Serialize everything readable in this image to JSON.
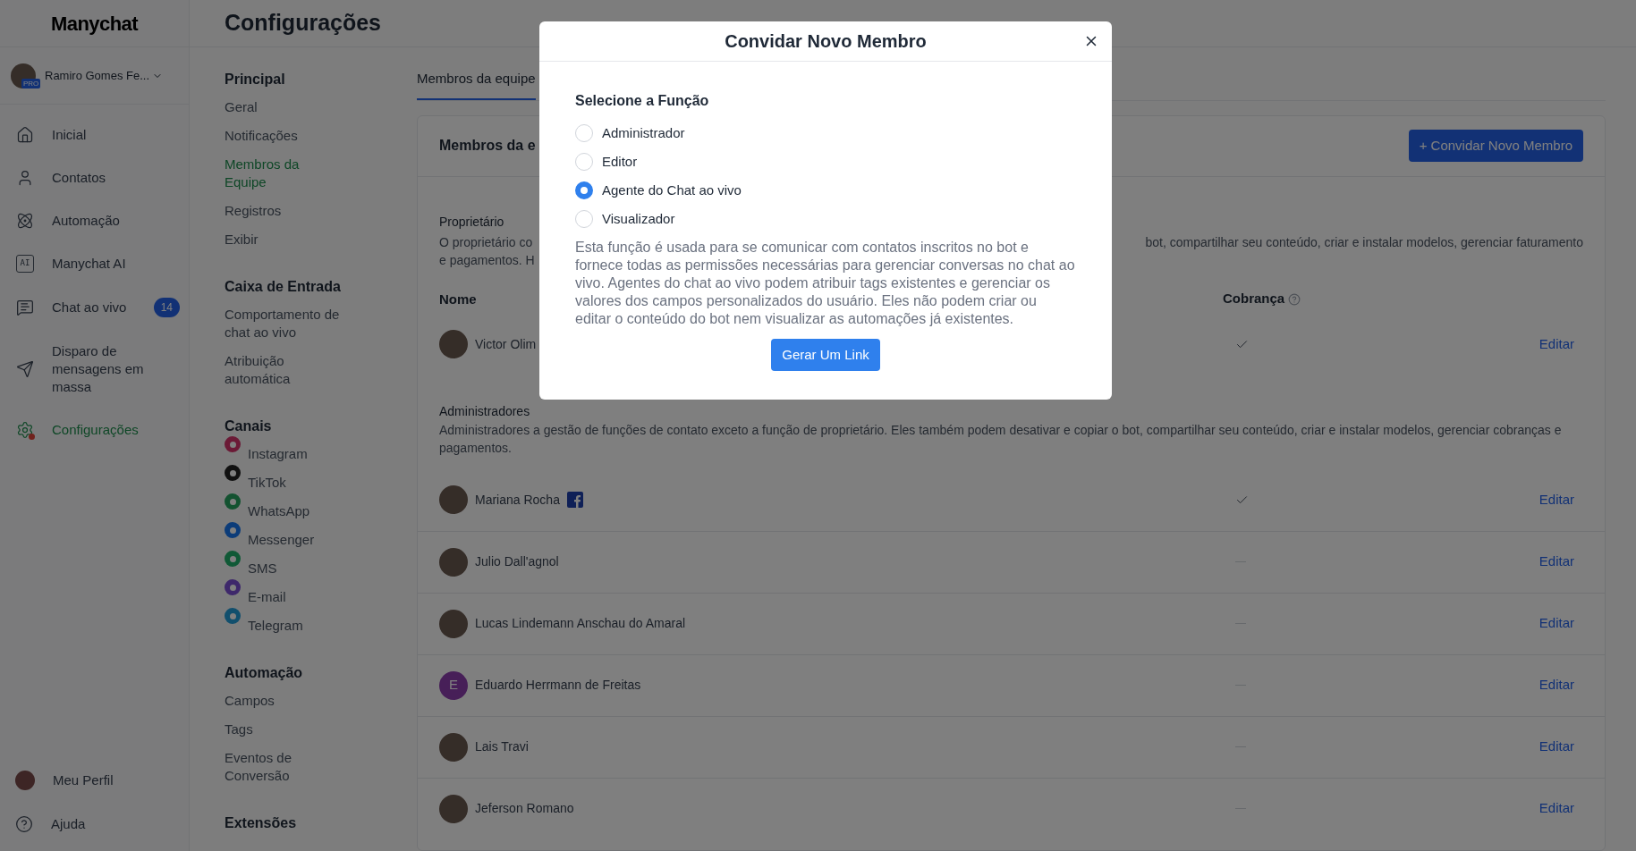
{
  "app": {
    "logo": "Manychat",
    "user": {
      "name": "Ramiro Gomes Fe...",
      "badge": "PRO"
    }
  },
  "sidebar": {
    "items": [
      {
        "kind": "home",
        "label": "Inicial",
        "selected": false
      },
      {
        "kind": "user",
        "label": "Contatos",
        "selected": false
      },
      {
        "kind": "atom",
        "label": "Automação",
        "selected": false
      },
      {
        "kind": "ai",
        "label": "Manychat AI",
        "selected": false,
        "icon_text": "AI"
      },
      {
        "kind": "chat",
        "label": "Chat ao vivo",
        "selected": false,
        "count": "14"
      },
      {
        "kind": "send",
        "label": "Disparo de mensagens em massa",
        "selected": false
      },
      {
        "kind": "settings",
        "label": "Configurações",
        "selected": true
      }
    ],
    "bottom": [
      {
        "kind": "avatar",
        "label": "Meu Perfil"
      },
      {
        "kind": "help",
        "label": "Ajuda"
      }
    ]
  },
  "page": {
    "title": "Configurações"
  },
  "settings_nav": [
    {
      "heading": "Principal",
      "items": [
        {
          "label": "Geral",
          "selected": false
        },
        {
          "label": "Notificações",
          "selected": false
        },
        {
          "label": "Membros da Equipe",
          "selected": true
        },
        {
          "label": "Registros",
          "selected": false
        },
        {
          "label": "Exibir",
          "selected": false
        }
      ]
    },
    {
      "heading": "Caixa de Entrada",
      "items": [
        {
          "label": "Comportamento de chat ao vivo",
          "selected": false
        },
        {
          "label": "Atribuição automática",
          "selected": false
        }
      ]
    },
    {
      "heading": "Canais",
      "items": [
        {
          "label": "Instagram",
          "selected": false,
          "color": "#6b1a36"
        },
        {
          "label": "TikTok",
          "selected": false,
          "color": "#111111"
        },
        {
          "label": "WhatsApp",
          "selected": false,
          "color": "#135230"
        },
        {
          "label": "Messenger",
          "selected": false,
          "color": "#0c3c79"
        },
        {
          "label": "SMS",
          "selected": false,
          "color": "#105936"
        },
        {
          "label": "E-mail",
          "selected": false,
          "color": "#3e286b"
        },
        {
          "label": "Telegram",
          "selected": false,
          "color": "#114f6d"
        }
      ]
    },
    {
      "heading": "Automação",
      "items": [
        {
          "label": "Campos",
          "selected": false
        },
        {
          "label": "Tags",
          "selected": false
        },
        {
          "label": "Eventos de Conversão",
          "selected": false
        }
      ]
    },
    {
      "heading": "Extensões"
    }
  ],
  "tabs": [
    {
      "label": "Membros da equipe",
      "selected": true
    }
  ],
  "card": {
    "title": "Membros da e",
    "invite_button": "+ Convidar Novo Membro",
    "owner": {
      "heading": "Proprietário",
      "description_left": [
        "O proprietário co",
        "e pagamentos. H"
      ],
      "description_right": "bot, compartilhar seu conteúdo, criar e instalar modelos, gerenciar faturamento"
    },
    "columns": [
      "Nome",
      "Cobrança"
    ],
    "owner_rows": [
      {
        "name": "Victor Olim",
        "billing": true,
        "action": "Editar"
      }
    ],
    "admins": {
      "heading": "Administradores",
      "description": "Administradores a gestão de funções de contato exceto a função de proprietário. Eles também podem desativar e copiar o bot, compartilhar seu conteúdo, criar e instalar modelos, gerenciar cobranças e pagamentos."
    },
    "admin_rows": [
      {
        "name": "Mariana Rocha",
        "facebook_badge": true,
        "billing": true,
        "action": "Editar"
      },
      {
        "name": "Julio Dall'agnol",
        "billing": false,
        "action": "Editar"
      },
      {
        "name": "Lucas Lindemann Anschau do Amaral",
        "billing": false,
        "action": "Editar"
      },
      {
        "name": "Eduardo Herrmann de Freitas",
        "initial": "E",
        "billing": false,
        "action": "Editar"
      },
      {
        "name": "Lais Travi",
        "billing": false,
        "action": "Editar"
      },
      {
        "name": "Jeferson Romano",
        "billing": false,
        "action": "Editar"
      }
    ]
  },
  "modal": {
    "title": "Convidar Novo Membro",
    "section": "Selecione a Função",
    "roles": [
      {
        "label": "Administrador",
        "selected": false
      },
      {
        "label": "Editor",
        "selected": false
      },
      {
        "label": "Agente do Chat ao vivo",
        "selected": true
      },
      {
        "label": "Visualizador",
        "selected": false
      }
    ],
    "description": "Esta função é usada para se comunicar com contatos inscritos no bot e fornece todas as permissões necessárias para gerenciar conversas no chat ao vivo. Agentes do chat ao vivo podem atribuir tags existentes e gerenciar os valores dos campos personalizados do usuário. Eles não podem criar ou editar o conteúdo do bot nem visualizar as automações já existentes.",
    "button": "Gerar Um Link"
  }
}
